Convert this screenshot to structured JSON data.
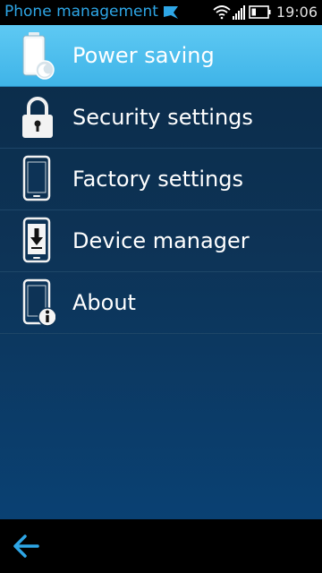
{
  "status_bar": {
    "title": "Phone management",
    "time": "19:06",
    "icons": [
      "chat-notification-icon",
      "wifi-icon",
      "signal-icon",
      "battery-icon"
    ]
  },
  "menu": {
    "items": [
      {
        "label": "Power saving",
        "icon": "battery-moon-icon",
        "selected": true
      },
      {
        "label": "Security settings",
        "icon": "lock-icon",
        "selected": false
      },
      {
        "label": "Factory settings",
        "icon": "phone-icon",
        "selected": false
      },
      {
        "label": "Device manager",
        "icon": "phone-download-icon",
        "selected": false
      },
      {
        "label": "About",
        "icon": "phone-info-icon",
        "selected": false
      }
    ]
  },
  "bottom_bar": {
    "back_icon": "back-arrow-icon"
  },
  "colors": {
    "accent": "#2ea6e6",
    "selected_row": "#4fbdee",
    "background_top": "#0b2b48",
    "background_bottom": "#0a4173"
  }
}
